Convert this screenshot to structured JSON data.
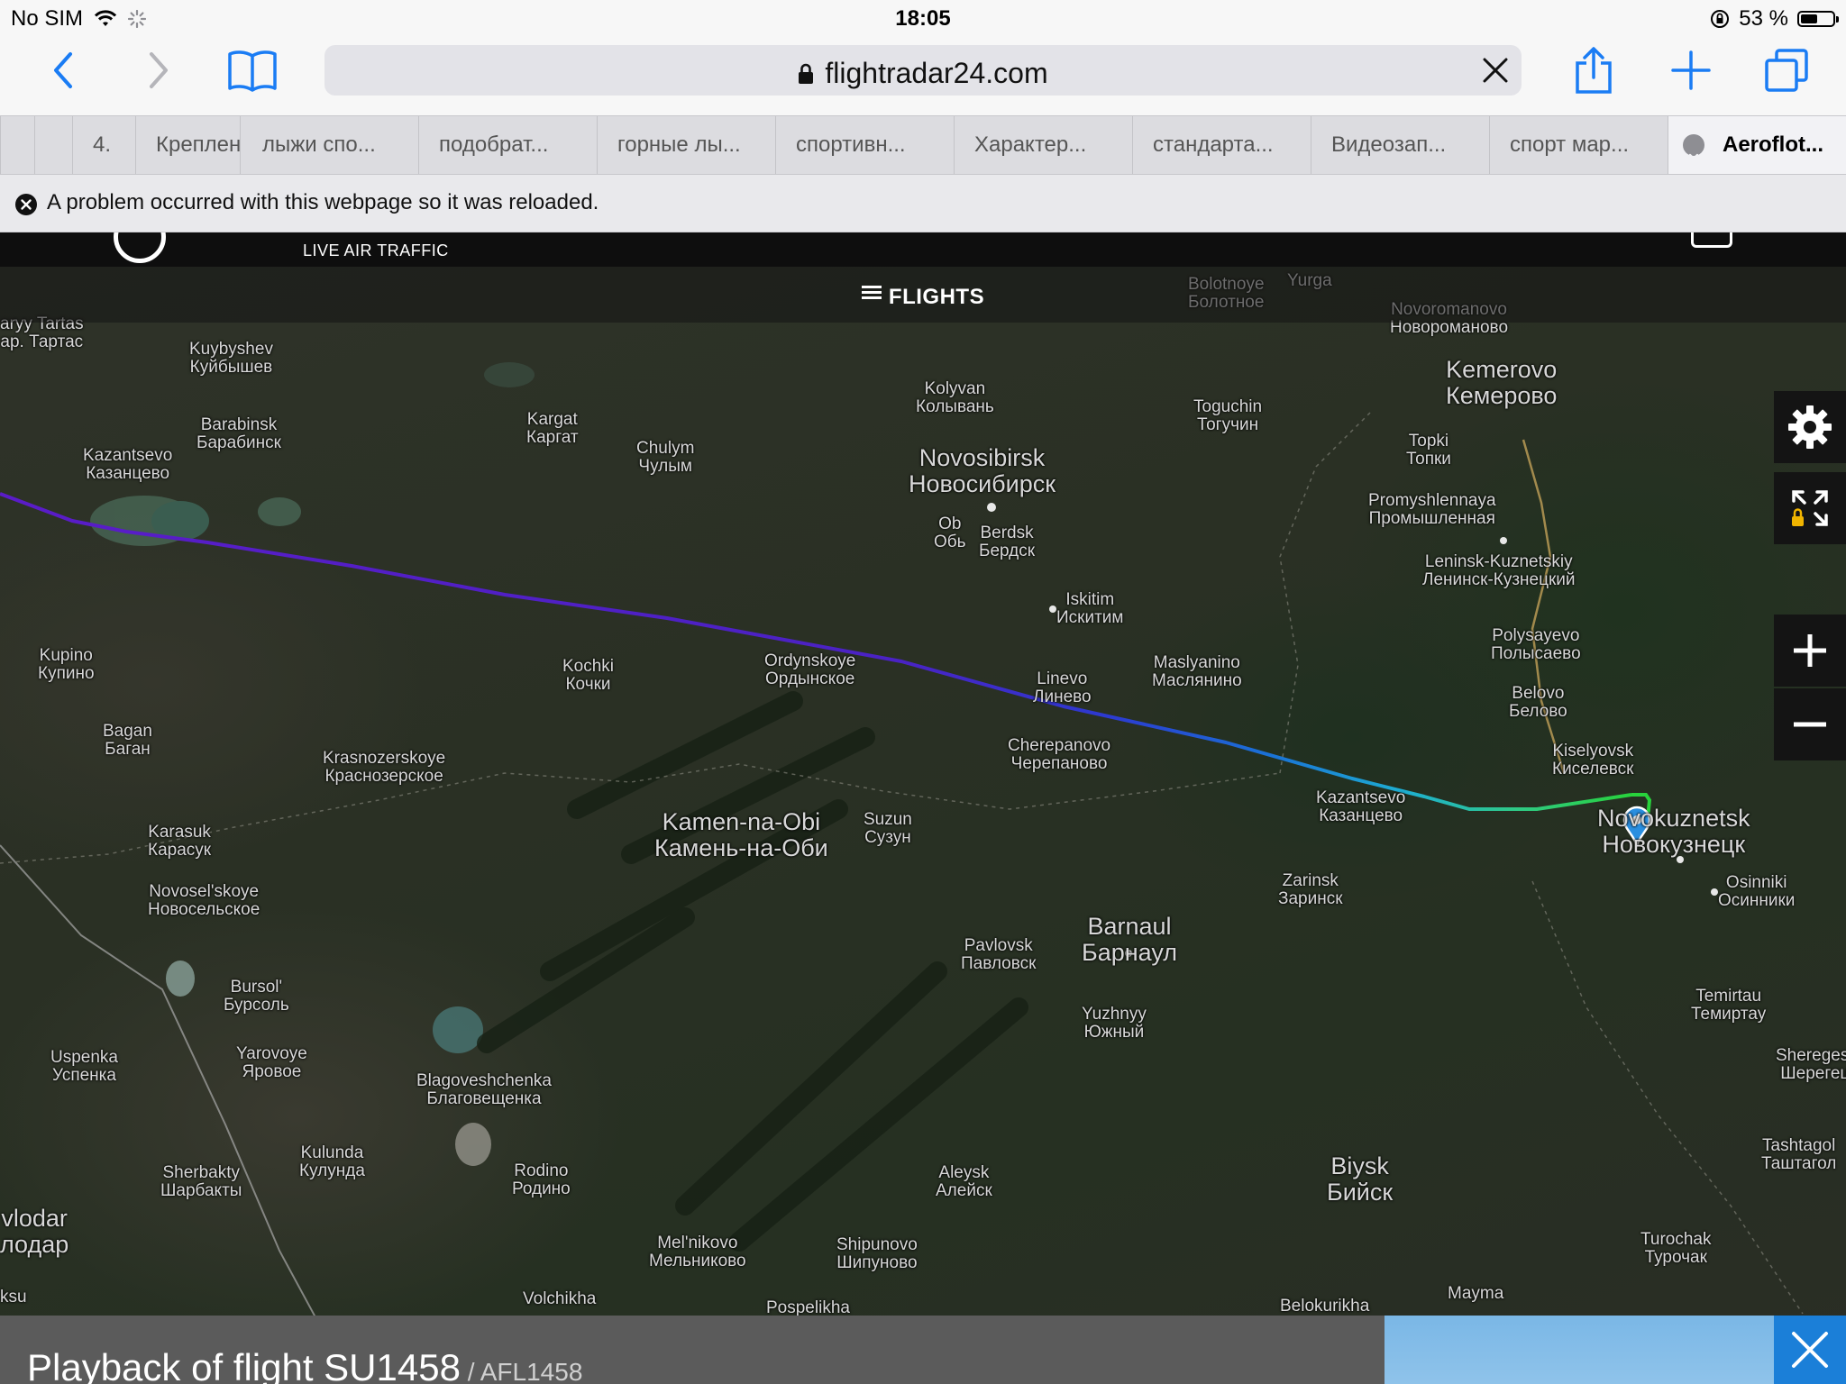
{
  "status_bar": {
    "carrier": "No SIM",
    "time": "18:05",
    "battery_percent": "53 %",
    "battery_level": 0.53
  },
  "toolbar": {
    "url": "flightradar24.com",
    "icons": [
      "back-icon",
      "forward-icon",
      "bookmarks-icon",
      "lock-icon",
      "clear-icon",
      "share-icon",
      "new-tab-icon",
      "tabs-icon"
    ]
  },
  "tabs": [
    {
      "label": ""
    },
    {
      "label": "4."
    },
    {
      "label": "Креплен"
    },
    {
      "label": "лыжи спо..."
    },
    {
      "label": "подобрат..."
    },
    {
      "label": "горные лы..."
    },
    {
      "label": "спортивн..."
    },
    {
      "label": "Характер..."
    },
    {
      "label": "стандарта..."
    },
    {
      "label": "Видеозап..."
    },
    {
      "label": "спорт мар..."
    },
    {
      "label": "Aeroflot..."
    }
  ],
  "notice": {
    "text": "A problem occurred with this webpage so it was reloaded."
  },
  "site": {
    "tagline": "LIVE AIR TRAFFIC",
    "flights_label": "FLIGHTS"
  },
  "cities": [
    {
      "en": "aryy Tartas",
      "ru": "ар. Тартас"
    },
    {
      "en": "Kuybyshev",
      "ru": "Куйбышев"
    },
    {
      "en": "Barabinsk",
      "ru": "Барабинск"
    },
    {
      "en": "Kazantsevo",
      "ru": "Казанцево"
    },
    {
      "en": "Kargat",
      "ru": "Каргат"
    },
    {
      "en": "Chulym",
      "ru": "Чулым"
    },
    {
      "en": "Kolyvan",
      "ru": "Колывань"
    },
    {
      "en": "Novosibirsk",
      "ru": "Новосибирск"
    },
    {
      "en": "Ob",
      "ru": "Обь"
    },
    {
      "en": "Berdsk",
      "ru": "Бердск"
    },
    {
      "en": "Iskitim",
      "ru": "Искитим"
    },
    {
      "en": "Toguchin",
      "ru": "Тогучин"
    },
    {
      "en": "Bolotnoye",
      "ru": "Болотное"
    },
    {
      "en": "Yurga",
      "ru": ""
    },
    {
      "en": "Novoromanovo",
      "ru": "Новороманово"
    },
    {
      "en": "Kemerovo",
      "ru": "Кемерово"
    },
    {
      "en": "Topki",
      "ru": "Топки"
    },
    {
      "en": "Promyshlennaya",
      "ru": "Промышленная"
    },
    {
      "en": "Leninsk-Kuznetskiy",
      "ru": "Ленинск-Кузнецкий"
    },
    {
      "en": "Polysayevo",
      "ru": "Полысаево"
    },
    {
      "en": "Belovo",
      "ru": "Белово"
    },
    {
      "en": "Kiselyovsk",
      "ru": "Киселевск"
    },
    {
      "en": "Novokuznetsk",
      "ru": "Новокузнецк"
    },
    {
      "en": "Osinniki",
      "ru": "Осинники"
    },
    {
      "en": "Kupino",
      "ru": "Купино"
    },
    {
      "en": "Kochki",
      "ru": "Кочки"
    },
    {
      "en": "Ordynskoye",
      "ru": "Ордынское"
    },
    {
      "en": "Linevo",
      "ru": "Линево"
    },
    {
      "en": "Maslyanino",
      "ru": "Маслянино"
    },
    {
      "en": "Bagan",
      "ru": "Баган"
    },
    {
      "en": "Krasnozerskoye",
      "ru": "Краснозерское"
    },
    {
      "en": "Cherepanovo",
      "ru": "Черепаново"
    },
    {
      "en": "Kazantsevo",
      "ru": "Казанцево"
    },
    {
      "en": "Karasuk",
      "ru": "Карасук"
    },
    {
      "en": "Kamen-na-Obi",
      "ru": "Камень-на-Оби"
    },
    {
      "en": "Suzun",
      "ru": "Сузун"
    },
    {
      "en": "Zarinsk",
      "ru": "Заринск"
    },
    {
      "en": "Novosel'skoye",
      "ru": "Новосельское"
    },
    {
      "en": "Pavlovsk",
      "ru": "Павловск"
    },
    {
      "en": "Barnaul",
      "ru": "Барнаул"
    },
    {
      "en": "Bursol'",
      "ru": "Бурсоль"
    },
    {
      "en": "Temirtau",
      "ru": "Темиртау"
    },
    {
      "en": "Yuzhnyy",
      "ru": "Южный"
    },
    {
      "en": "Uspenka",
      "ru": "Успенка"
    },
    {
      "en": "Yarovoye",
      "ru": "Яровое"
    },
    {
      "en": "Blagoveshchenka",
      "ru": "Благовещенка"
    },
    {
      "en": "Sheregesh",
      "ru": "Шерегеш"
    },
    {
      "en": "Kulunda",
      "ru": "Кулунда"
    },
    {
      "en": "Sherbakty",
      "ru": "Шарбакты"
    },
    {
      "en": "Rodino",
      "ru": "Родино"
    },
    {
      "en": "Aleysk",
      "ru": "Алейск"
    },
    {
      "en": "Biysk",
      "ru": "Бийск"
    },
    {
      "en": "Tashtagol",
      "ru": "Таштагол"
    },
    {
      "en": "vlodar",
      "ru": "лодар"
    },
    {
      "en": "Mel'nikovo",
      "ru": "Мельниково"
    },
    {
      "en": "Shipunovo",
      "ru": "Шипуново"
    },
    {
      "en": "Turochak",
      "ru": "Турочак"
    },
    {
      "en": "Volchikha",
      "ru": ""
    },
    {
      "en": "Pospelikha",
      "ru": ""
    },
    {
      "en": "Belokurikha",
      "ru": ""
    },
    {
      "en": "Mayma",
      "ru": ""
    },
    {
      "en": "ksu",
      "ru": ""
    }
  ],
  "map_controls": [
    "settings-icon",
    "fullscreen-icon",
    "zoom-in-icon",
    "zoom-out-icon"
  ],
  "playback": {
    "title": "Playback of flight SU1458",
    "callsign": " / AFL1458"
  }
}
